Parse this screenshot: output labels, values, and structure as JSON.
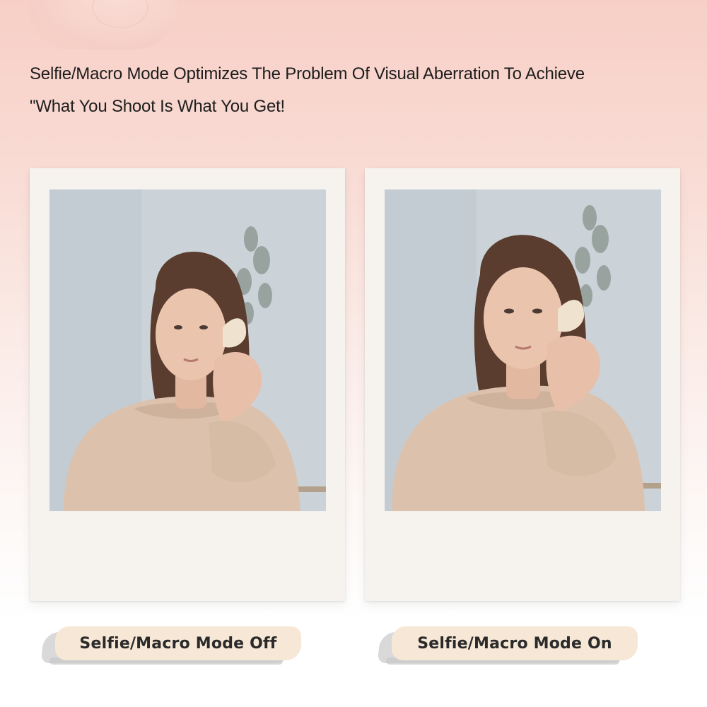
{
  "headline": {
    "line1": "Selfie/Macro Mode Optimizes The Problem Of Visual Aberration To Achieve",
    "line2": "\"What You Shoot Is What You Get!"
  },
  "comparison": {
    "off": {
      "label": "Selfie/Macro Mode Off"
    },
    "on": {
      "label": "Selfie/Macro Mode On"
    }
  },
  "colors": {
    "background_top": "#f7cfc6",
    "polaroid_frame": "#f6f3ee",
    "label_paper": "#f6e7d6",
    "wall": "#c9d0d6",
    "blouse": "#dcc2ad",
    "hair": "#5a3d2e"
  },
  "icons": [
    "camera-decoration"
  ]
}
